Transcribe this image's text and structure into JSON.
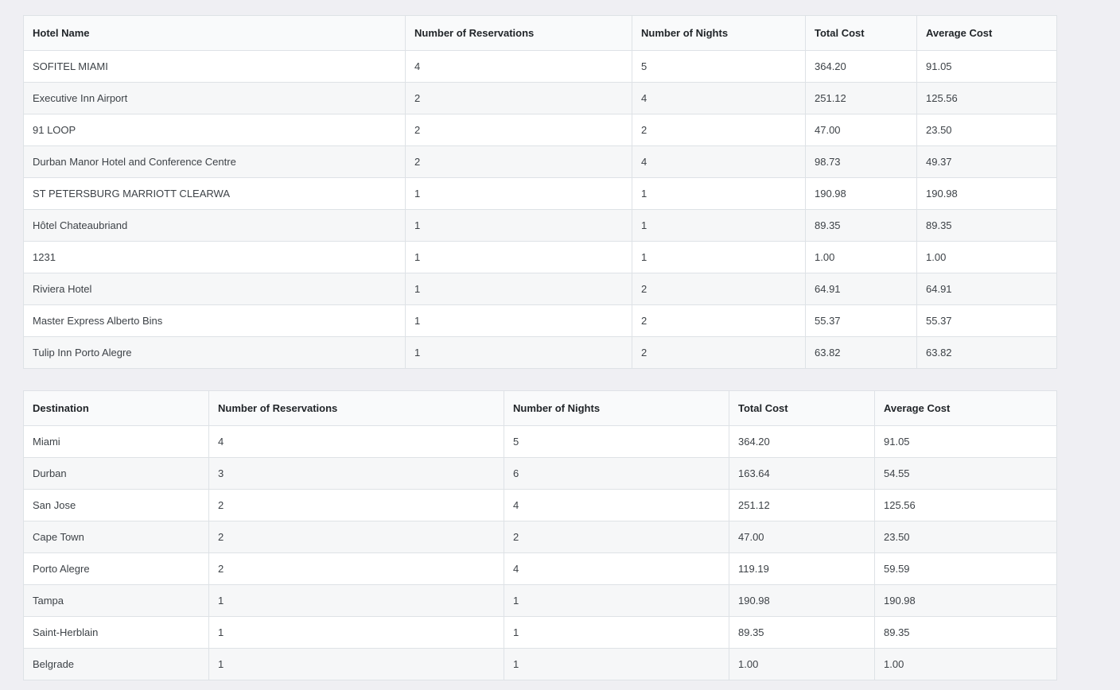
{
  "hotel_table": {
    "headers": [
      "Hotel Name",
      "Number of Reservations",
      "Number of Nights",
      "Total Cost",
      "Average Cost"
    ],
    "rows": [
      [
        "SOFITEL MIAMI",
        "4",
        "5",
        "364.20",
        "91.05"
      ],
      [
        "Executive Inn Airport",
        "2",
        "4",
        "251.12",
        "125.56"
      ],
      [
        "91 LOOP",
        "2",
        "2",
        "47.00",
        "23.50"
      ],
      [
        "Durban Manor Hotel and Conference Centre",
        "2",
        "4",
        "98.73",
        "49.37"
      ],
      [
        "ST PETERSBURG MARRIOTT CLEARWA",
        "1",
        "1",
        "190.98",
        "190.98"
      ],
      [
        "Hôtel Chateaubriand",
        "1",
        "1",
        "89.35",
        "89.35"
      ],
      [
        "1231",
        "1",
        "1",
        "1.00",
        "1.00"
      ],
      [
        "Riviera Hotel",
        "1",
        "2",
        "64.91",
        "64.91"
      ],
      [
        "Master Express Alberto Bins",
        "1",
        "2",
        "55.37",
        "55.37"
      ],
      [
        "Tulip Inn Porto Alegre",
        "1",
        "2",
        "63.82",
        "63.82"
      ]
    ]
  },
  "destination_table": {
    "headers": [
      "Destination",
      "Number of Reservations",
      "Number of Nights",
      "Total Cost",
      "Average Cost"
    ],
    "rows": [
      [
        "Miami",
        "4",
        "5",
        "364.20",
        "91.05"
      ],
      [
        "Durban",
        "3",
        "6",
        "163.64",
        "54.55"
      ],
      [
        "San Jose",
        "2",
        "4",
        "251.12",
        "125.56"
      ],
      [
        "Cape Town",
        "2",
        "2",
        "47.00",
        "23.50"
      ],
      [
        "Porto Alegre",
        "2",
        "4",
        "119.19",
        "59.59"
      ],
      [
        "Tampa",
        "1",
        "1",
        "190.98",
        "190.98"
      ],
      [
        "Saint-Herblain",
        "1",
        "1",
        "89.35",
        "89.35"
      ],
      [
        "Belgrade",
        "1",
        "1",
        "1.00",
        "1.00"
      ]
    ]
  }
}
